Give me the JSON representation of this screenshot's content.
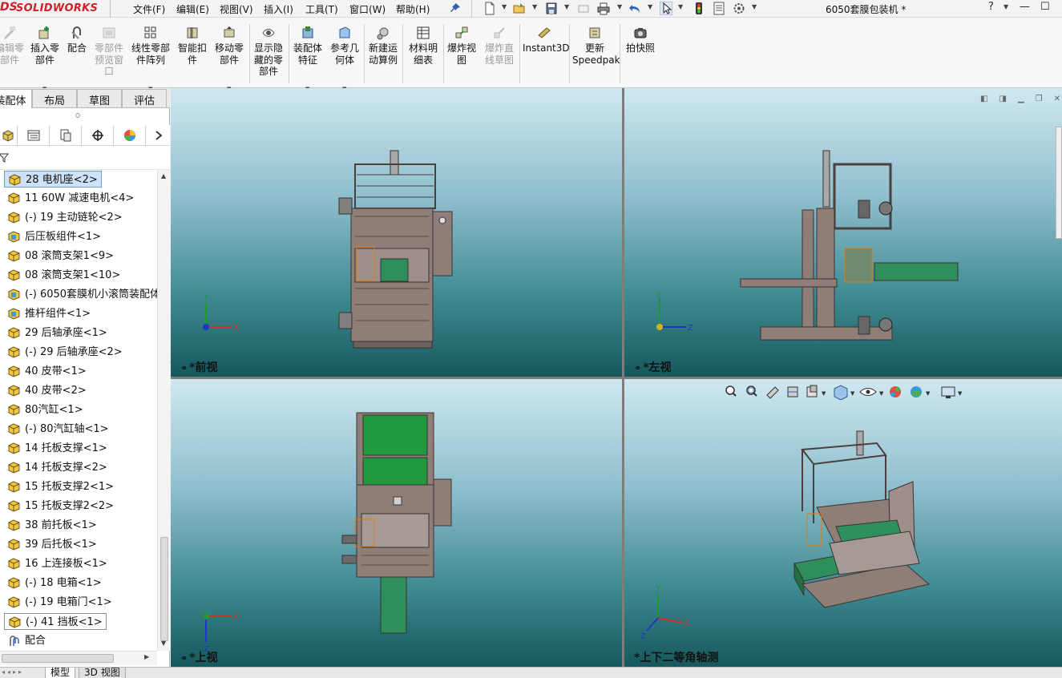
{
  "app": {
    "logo_prefix": "DS",
    "logo_text": "SOLIDWORKS",
    "document_title": "6050套膜包装机 *"
  },
  "menu": [
    "文件(F)",
    "编辑(E)",
    "视图(V)",
    "插入(I)",
    "工具(T)",
    "窗口(W)",
    "帮助(H)"
  ],
  "quick_access_icons": [
    "pin-icon",
    "new-document-icon",
    "open-icon",
    "save-icon",
    "print-icon",
    "undo-icon",
    "select-icon",
    "rebuild-icon",
    "file-properties-icon",
    "options-icon"
  ],
  "window_controls": {
    "help": "?",
    "minimize": "—",
    "maximize": "☐"
  },
  "commands": [
    {
      "label": "编辑零\n部件",
      "icon": "edit-component-icon",
      "enabled": false
    },
    {
      "label": "插入零\n部件",
      "icon": "insert-component-icon",
      "enabled": true,
      "dropdown": true
    },
    {
      "label": "配合",
      "icon": "mate-icon",
      "enabled": true
    },
    {
      "label": "零部件\n预览窗\n口",
      "icon": "component-preview-icon",
      "enabled": false
    },
    {
      "label": "线性零部\n件阵列",
      "icon": "linear-pattern-icon",
      "enabled": true,
      "dropdown": true
    },
    {
      "label": "智能扣\n件",
      "icon": "smart-fasteners-icon",
      "enabled": true
    },
    {
      "label": "移动零\n部件",
      "icon": "move-component-icon",
      "enabled": true,
      "dropdown": true
    },
    {
      "label": "显示隐\n藏的零\n部件",
      "icon": "show-hidden-icon",
      "enabled": true
    },
    {
      "label": "装配体\n特征",
      "icon": "assembly-features-icon",
      "enabled": true,
      "dropdown": true
    },
    {
      "label": "参考几\n何体",
      "icon": "reference-geometry-icon",
      "enabled": true,
      "dropdown": true
    },
    {
      "label": "新建运\n动算例",
      "icon": "new-motion-study-icon",
      "enabled": true
    },
    {
      "label": "材料明\n细表",
      "icon": "bill-of-materials-icon",
      "enabled": true
    },
    {
      "label": "爆炸视\n图",
      "icon": "exploded-view-icon",
      "enabled": true
    },
    {
      "label": "爆炸直\n线草图",
      "icon": "explode-line-sketch-icon",
      "enabled": false
    },
    {
      "label": "Instant3D",
      "icon": "instant3d-icon",
      "enabled": true
    },
    {
      "label": "更新\nSpeedpak",
      "icon": "update-speedpak-icon",
      "enabled": true
    },
    {
      "label": "拍快照",
      "icon": "snapshot-icon",
      "enabled": true
    }
  ],
  "command_tabs": [
    "装配体",
    "布局",
    "草图",
    "评估"
  ],
  "manager_tabs": [
    "feature-manager-icon",
    "property-manager-icon",
    "configuration-manager-icon",
    "dimxpert-icon",
    "display-manager-icon",
    "chevron-right-icon"
  ],
  "tree_items": [
    {
      "label": "28 电机座<2>",
      "icon": "part-yellow-icon",
      "selected": true
    },
    {
      "label": "11 60W 减速电机<4>",
      "icon": "part-yellow-icon"
    },
    {
      "label": "(-) 19 主动链轮<2>",
      "icon": "part-yellow-icon"
    },
    {
      "label": "后压板组件<1>",
      "icon": "subassembly-icon"
    },
    {
      "label": "08 滚筒支架1<9>",
      "icon": "part-yellow-icon"
    },
    {
      "label": "08 滚筒支架1<10>",
      "icon": "part-yellow-icon"
    },
    {
      "label": "(-) 6050套膜机小滚筒装配体",
      "icon": "subassembly-icon"
    },
    {
      "label": "推杆组件<1>",
      "icon": "subassembly-icon"
    },
    {
      "label": "29 后轴承座<1>",
      "icon": "part-yellow-icon"
    },
    {
      "label": "(-) 29 后轴承座<2>",
      "icon": "part-yellow-icon"
    },
    {
      "label": "40 皮带<1>",
      "icon": "part-yellow-icon"
    },
    {
      "label": "40 皮带<2>",
      "icon": "part-yellow-icon"
    },
    {
      "label": "80汽缸<1>",
      "icon": "part-yellow-icon"
    },
    {
      "label": "(-) 80汽缸轴<1>",
      "icon": "part-yellow-icon"
    },
    {
      "label": "14 托板支撑<1>",
      "icon": "part-yellow-icon"
    },
    {
      "label": "14 托板支撑<2>",
      "icon": "part-yellow-icon"
    },
    {
      "label": "15 托板支撑2<1>",
      "icon": "part-yellow-icon"
    },
    {
      "label": "15 托板支撑2<2>",
      "icon": "part-yellow-icon"
    },
    {
      "label": "38 前托板<1>",
      "icon": "part-yellow-icon"
    },
    {
      "label": "39 后托板<1>",
      "icon": "part-yellow-icon"
    },
    {
      "label": "16 上连接板<1>",
      "icon": "part-yellow-icon"
    },
    {
      "label": "(-) 18 电箱<1>",
      "icon": "part-yellow-icon"
    },
    {
      "label": "(-) 19 电箱门<1>",
      "icon": "part-yellow-icon"
    },
    {
      "label": "(-) 41 挡板<1>",
      "icon": "part-yellow-icon",
      "boxed": true
    },
    {
      "label": "配合",
      "icon": "mates-folder-icon"
    }
  ],
  "viewports": [
    {
      "label": "*前视",
      "axes": [
        "Y",
        "X"
      ]
    },
    {
      "label": "*左视",
      "axes": [
        "Y",
        "Z"
      ]
    },
    {
      "label": "*上视",
      "axes": [
        "X",
        "Z"
      ]
    },
    {
      "label": "*上下二等角轴测",
      "axes": [
        "Y",
        "X",
        "Z"
      ]
    }
  ],
  "heads_up_toolbar": [
    "zoom-to-fit-icon",
    "zoom-area-icon",
    "previous-view-icon",
    "section-view-icon",
    "dynamic-annotation-icon",
    "view-orientation-icon",
    "display-style-icon",
    "hide-show-items-icon",
    "edit-appearance-icon",
    "apply-scene-icon",
    "view-settings-icon"
  ],
  "viewport_pane_icons": [
    "pane-prev-icon",
    "pane-next-icon",
    "pane-minimize-icon",
    "pane-restore-icon",
    "pane-close-icon"
  ],
  "status_tabs": [
    "模型",
    "3D 视图"
  ],
  "colors": {
    "brand_red": "#d21f2a",
    "viewport_top": "#cfe8f0",
    "viewport_bottom": "#16585c",
    "selection_blue": "#cde1f8",
    "machine_frame": "#8f7d78",
    "belt_green": "#2e8f5a"
  }
}
